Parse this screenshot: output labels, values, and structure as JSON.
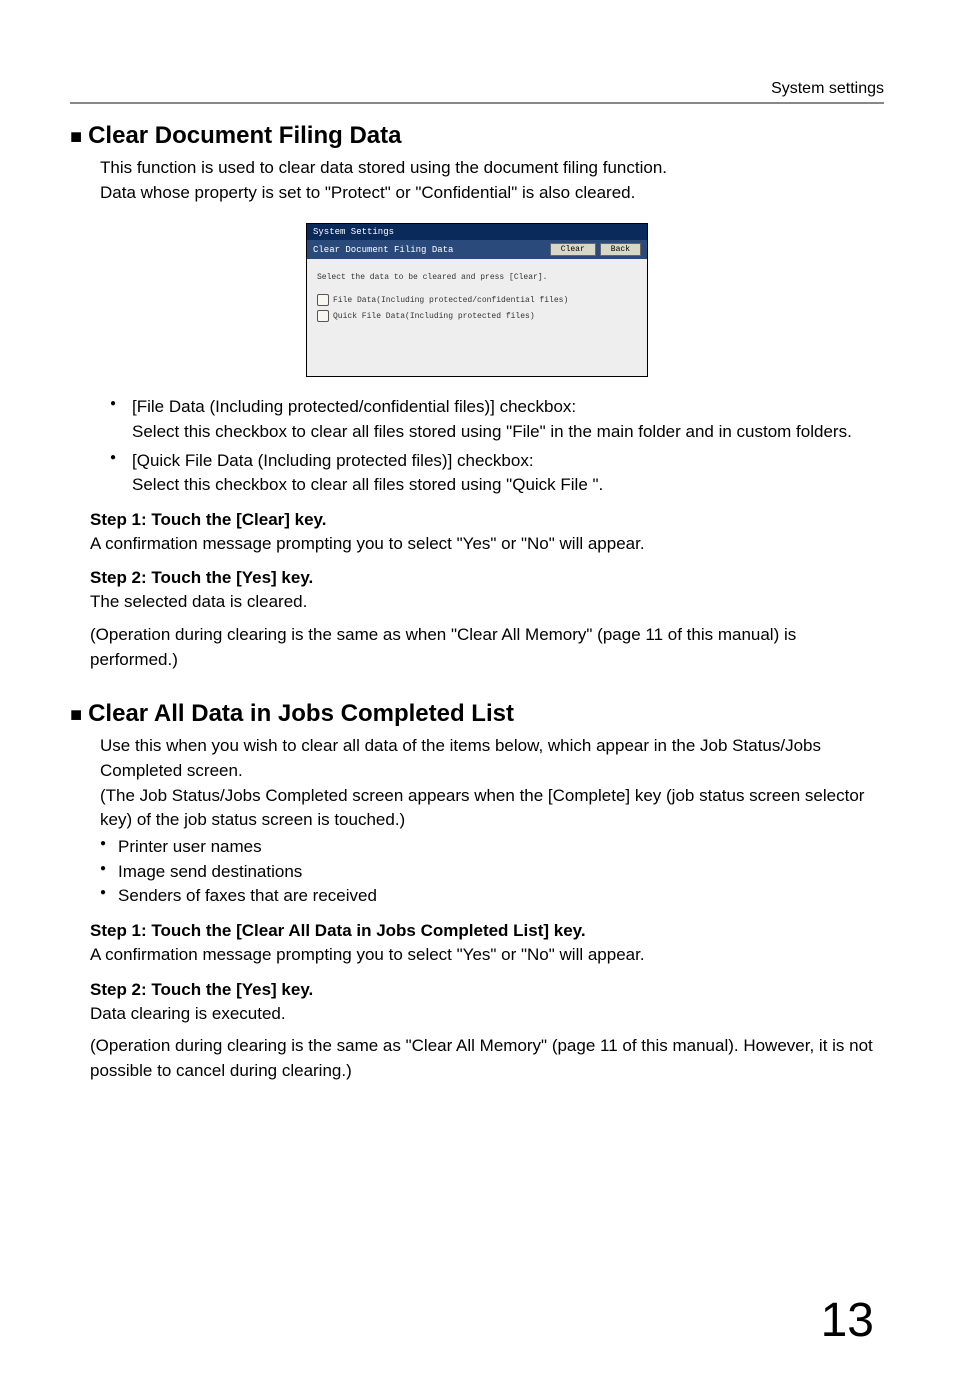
{
  "header": {
    "section": "System settings"
  },
  "section1": {
    "title": "Clear Document Filing Data",
    "intro1": "This function is used to clear data stored using the document filing function.",
    "intro2": "Data whose property is set to \"Protect\" or \"Confidential\" is also cleared.",
    "screenshot": {
      "top": "System Settings",
      "title": "Clear Document Filing Data",
      "btn_clear": "Clear",
      "btn_back": "Back",
      "line1": "Select the data to be cleared and press [Clear].",
      "line2": "File Data(Including protected/confidential files)",
      "line3": "Quick File Data(Including protected files)"
    },
    "bullets": [
      {
        "head": "[File Data (Including protected/confidential files)] checkbox:",
        "body": "Select this checkbox to clear all files stored using \"File\" in the main folder and in custom folders."
      },
      {
        "head": "[Quick File Data (Including protected files)] checkbox:",
        "body": "Select this checkbox to clear all files stored using \"Quick File \"."
      }
    ],
    "step1_title": "Step 1: Touch the [Clear] key.",
    "step1_body": "A confirmation message prompting you to select \"Yes\" or \"No\" will appear.",
    "step2_title": "Step 2: Touch the [Yes] key.",
    "step2_body1": "The selected data is cleared.",
    "step2_body2": "(Operation during clearing is the same as when \"Clear All Memory\" (page 11 of this manual) is performed.)"
  },
  "section2": {
    "title": "Clear All Data in Jobs Completed List",
    "intro1": "Use this when you wish to clear all data of the items below, which appear in the Job Status/Jobs Completed screen.",
    "intro2": " (The Job Status/Jobs Completed screen appears when the [Complete] key (job status screen selector key) of the job status screen is touched.)",
    "items": [
      "Printer user names",
      "Image send destinations",
      "Senders of faxes that are received"
    ],
    "step1_title": "Step 1: Touch the [Clear All Data in Jobs Completed List] key.",
    "step1_body": "A confirmation message prompting you to select \"Yes\" or \"No\" will appear.",
    "step2_title": "Step 2: Touch the [Yes] key.",
    "step2_body1": "Data clearing is executed.",
    "step2_body2": "(Operation during clearing is the same as \"Clear All Memory\" (page 11 of this manual). However, it is not possible to cancel during clearing.)"
  },
  "page_number": "13"
}
